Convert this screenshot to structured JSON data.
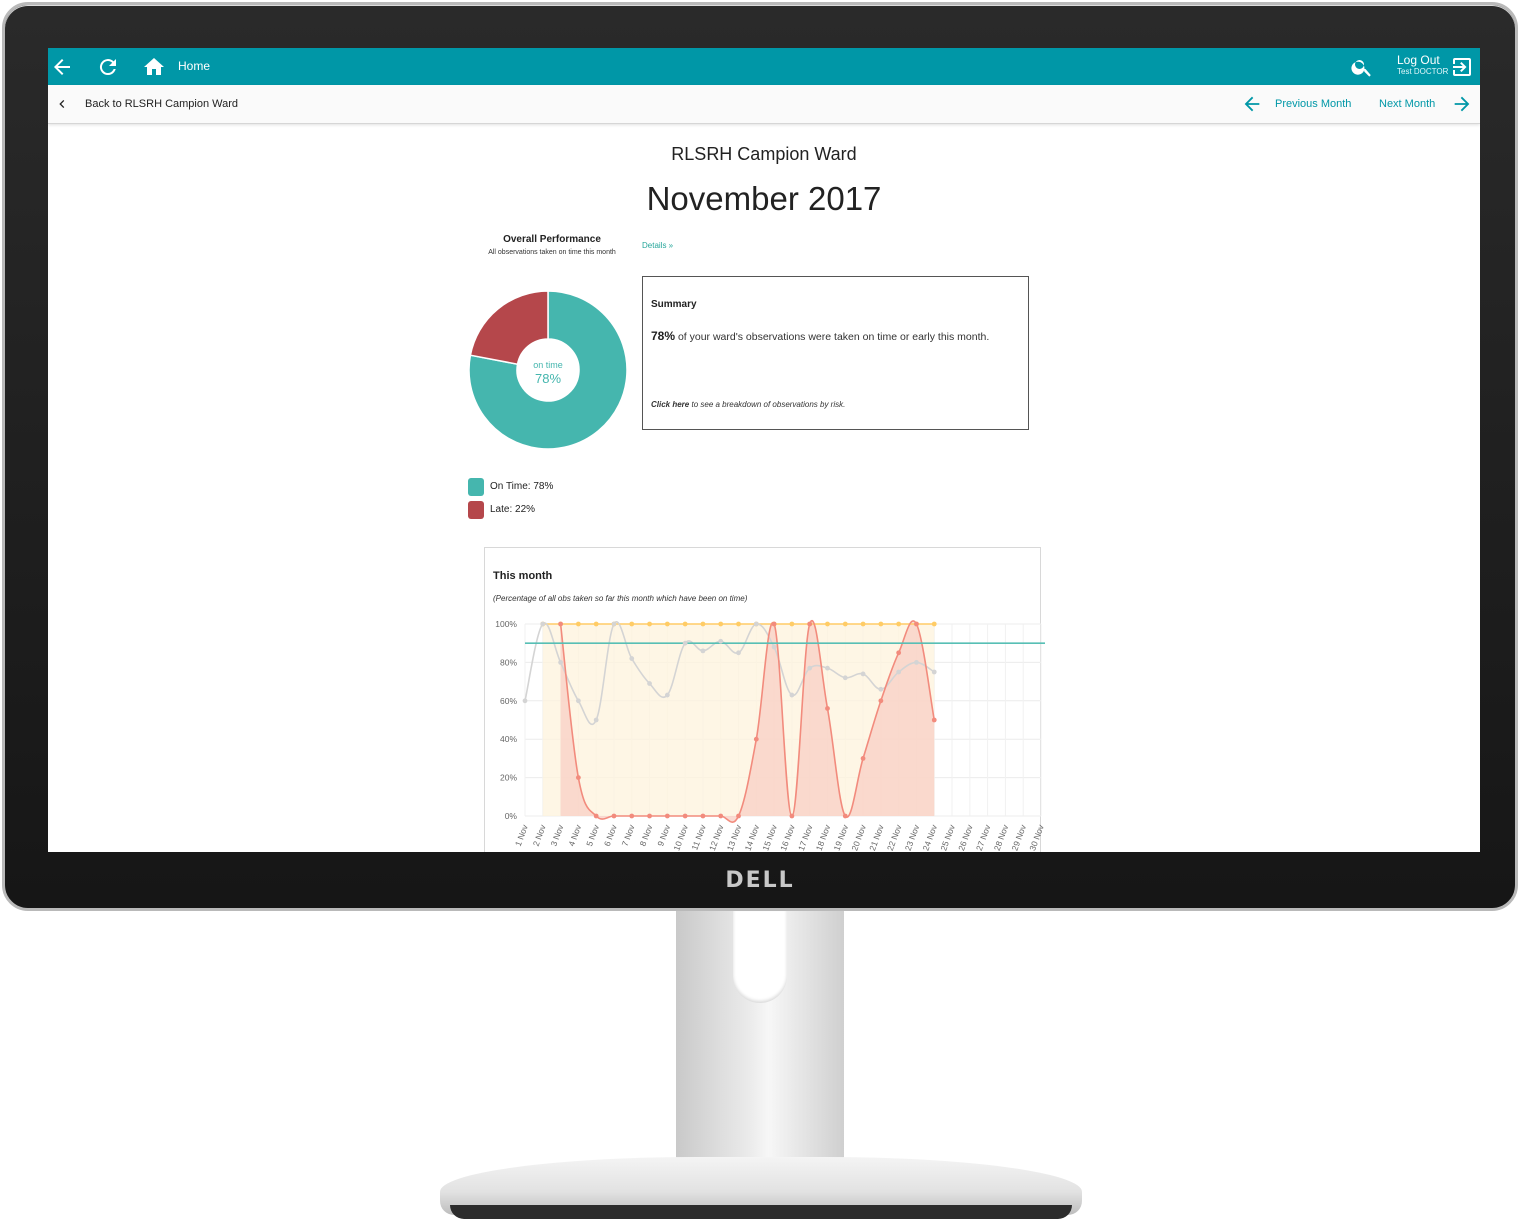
{
  "monitor": {
    "brand": "DELL"
  },
  "topbar": {
    "home_label": "Home",
    "logout_label": "Log Out",
    "user_label": "Test DOCTOR",
    "color": "#0097a7"
  },
  "subbar": {
    "back_label": "Back to RLSRH Campion Ward",
    "previous_label": "Previous Month",
    "next_label": "Next Month"
  },
  "page": {
    "ward_title": "RLSRH Campion Ward",
    "month_title": "November 2017"
  },
  "performance": {
    "title": "Overall Performance",
    "subtitle": "All observations taken on time this month",
    "details_link": "Details »",
    "center_label": "on time",
    "center_value": "78%",
    "on_time_pct": 78,
    "late_pct": 22,
    "colors": {
      "on_time": "#45b6ae",
      "late": "#b5474b"
    },
    "legend": [
      {
        "label": "On Time: 78%",
        "color": "#45b6ae"
      },
      {
        "label": "Late: 22%",
        "color": "#b5474b"
      }
    ]
  },
  "summary": {
    "title": "Summary",
    "pct": "78%",
    "text": " of your ward's observations were taken on time or early this month.",
    "foot_bold": "Click here",
    "foot_rest": " to see a breakdown of observations by risk."
  },
  "chart_card": {
    "title": "This month",
    "subtitle": "(Percentage of all obs taken so far this month which have been on time)"
  },
  "chart_data": {
    "type": "line",
    "x": [
      "1 Nov",
      "2 Nov",
      "3 Nov",
      "4 Nov",
      "5 Nov",
      "6 Nov",
      "7 Nov",
      "8 Nov",
      "9 Nov",
      "10 Nov",
      "11 Nov",
      "12 Nov",
      "13 Nov",
      "14 Nov",
      "15 Nov",
      "16 Nov",
      "17 Nov",
      "18 Nov",
      "19 Nov",
      "20 Nov",
      "21 Nov",
      "22 Nov",
      "23 Nov",
      "24 Nov",
      "25 Nov",
      "26 Nov",
      "27 Nov",
      "28 Nov",
      "29 Nov",
      "30 Nov"
    ],
    "ylim": [
      0,
      100
    ],
    "yticks": [
      "0%",
      "20%",
      "40%",
      "60%",
      "80%",
      "100%"
    ],
    "target": 90,
    "grid": true,
    "series": [
      {
        "color": "#ffcc66",
        "fill": "#fdf3dc",
        "values": [
          null,
          100,
          100,
          100,
          100,
          100,
          100,
          100,
          100,
          100,
          100,
          100,
          100,
          100,
          100,
          100,
          100,
          100,
          100,
          100,
          100,
          100,
          100,
          100,
          null,
          null,
          null,
          null,
          null,
          null
        ]
      },
      {
        "color": "#d4d4d4",
        "fill": null,
        "values": [
          60,
          100,
          80,
          60,
          50,
          100,
          82,
          69,
          63,
          90,
          86,
          91,
          85,
          100,
          88,
          63,
          77,
          77,
          72,
          74,
          66,
          75,
          80,
          75,
          null,
          null,
          null,
          null,
          null,
          null
        ]
      },
      {
        "color": "#f28b7d",
        "fill": "#f8cfc4",
        "values": [
          null,
          null,
          100,
          20,
          0,
          0,
          0,
          0,
          0,
          0,
          0,
          0,
          0,
          40,
          100,
          0,
          100,
          56,
          0,
          30,
          60,
          85,
          100,
          50,
          null,
          null,
          null,
          null,
          null,
          null
        ]
      }
    ],
    "target_color": "#57bfb5"
  }
}
